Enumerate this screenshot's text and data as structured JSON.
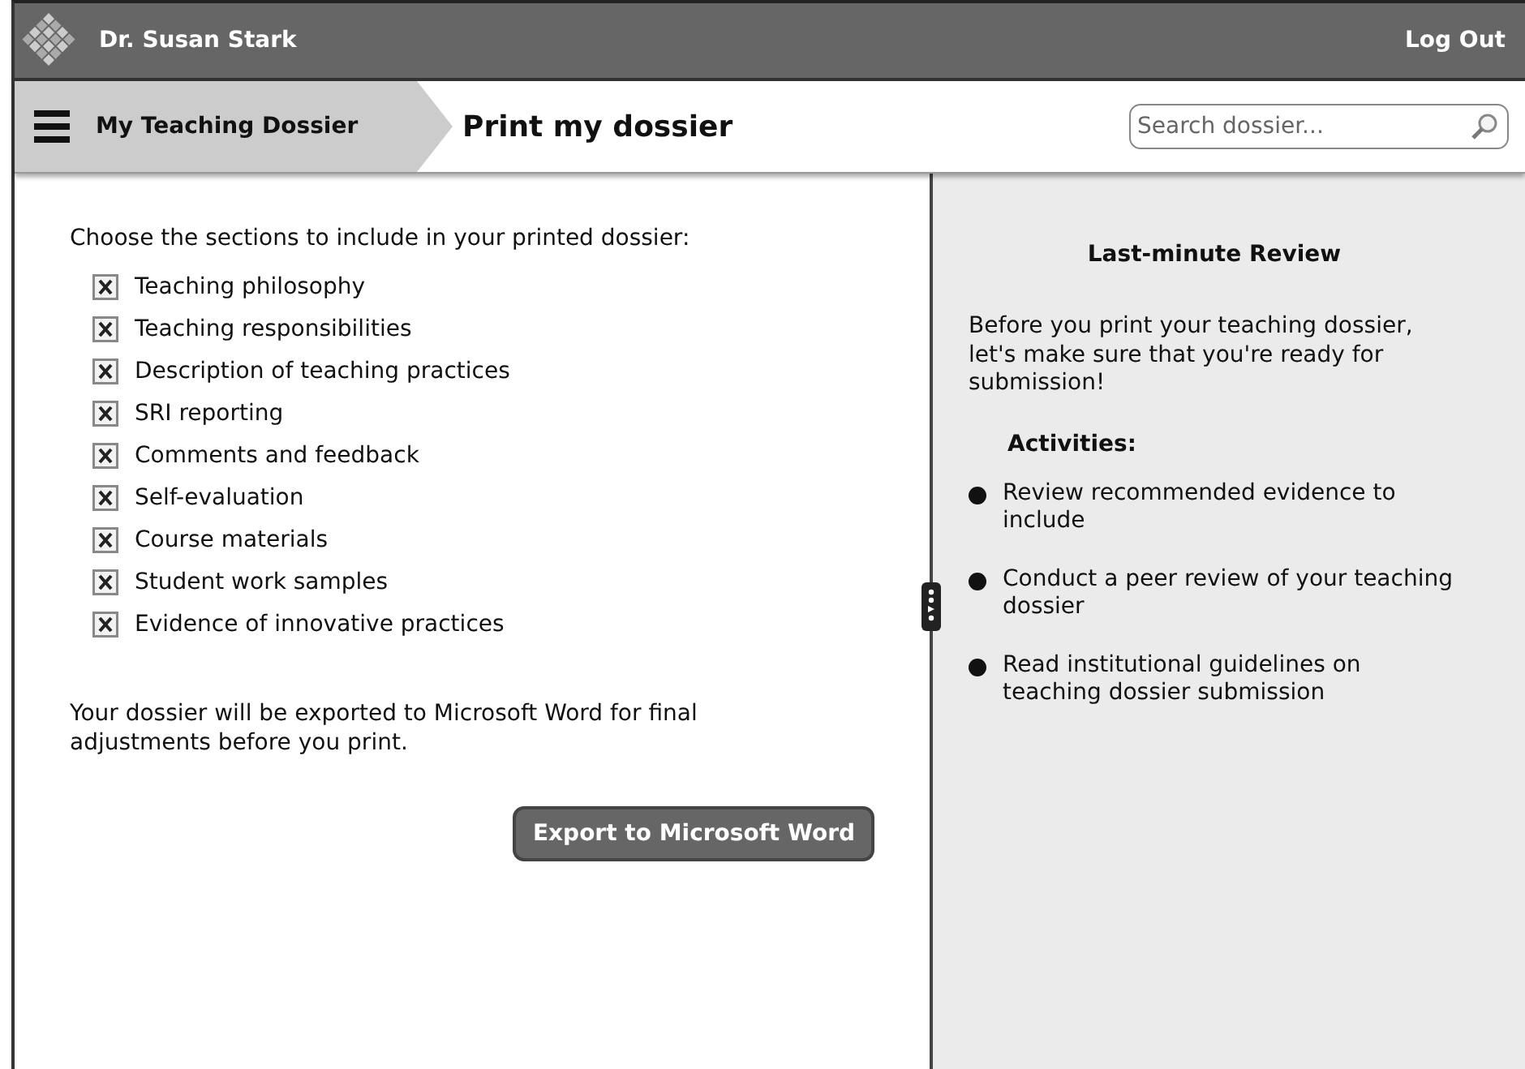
{
  "header": {
    "user_name": "Dr. Susan Stark",
    "logout": "Log Out"
  },
  "breadcrumb": {
    "parent": "My Teaching Dossier",
    "current": "Print my dossier"
  },
  "search": {
    "placeholder": "Search dossier..."
  },
  "main": {
    "intro": "Choose the sections to include in your printed dossier:",
    "sections": [
      {
        "label": "Teaching philosophy",
        "checked": true
      },
      {
        "label": "Teaching responsibilities",
        "checked": true
      },
      {
        "label": "Description of teaching practices",
        "checked": true
      },
      {
        "label": "SRI reporting",
        "checked": true
      },
      {
        "label": "Comments and feedback",
        "checked": true
      },
      {
        "label": "Self-evaluation",
        "checked": true
      },
      {
        "label": "Course materials",
        "checked": true
      },
      {
        "label": "Student work samples",
        "checked": true
      },
      {
        "label": "Evidence of innovative practices",
        "checked": true
      }
    ],
    "note": "Your dossier will be exported to Microsoft Word for final adjustments before you print.",
    "export_button": "Export to Microsoft Word"
  },
  "review": {
    "title": "Last-minute Review",
    "intro": "Before you print your teaching dossier, let's make sure that you're ready for submission!",
    "activities_heading": "Activities:",
    "activities": [
      "Review recommended evidence to include",
      "Conduct a peer review of your teaching dossier",
      "Read institutional guidelines on teaching dossier submission"
    ]
  }
}
